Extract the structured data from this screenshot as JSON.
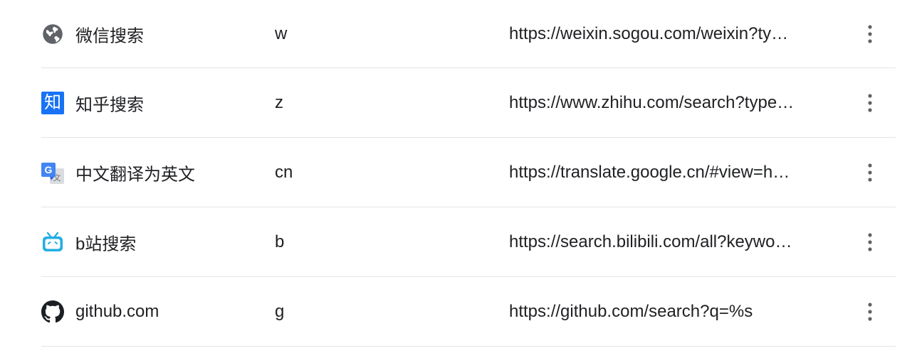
{
  "engines": [
    {
      "name": "微信搜索",
      "keyword": "w",
      "url": "https://weixin.sogou.com/weixin?ty…",
      "icon": "globe-icon"
    },
    {
      "name": "知乎搜索",
      "keyword": "z",
      "url": "https://www.zhihu.com/search?type…",
      "icon": "zhihu-icon",
      "icon_text": "知"
    },
    {
      "name": "中文翻译为英文",
      "keyword": "cn",
      "url": "https://translate.google.cn/#view=h…",
      "icon": "google-translate-icon"
    },
    {
      "name": "b站搜索",
      "keyword": "b",
      "url": "https://search.bilibili.com/all?keywo…",
      "icon": "bilibili-icon"
    },
    {
      "name": "github.com",
      "keyword": "g",
      "url": "https://github.com/search?q=%s",
      "icon": "github-icon"
    }
  ],
  "colors": {
    "text": "#202124",
    "divider": "#e4e4e4",
    "menu_dots": "#5f6368",
    "zhihu_blue": "#1772f6",
    "bilibili_blue": "#23ade5",
    "google_blue": "#4285f4"
  },
  "menu_icon": "more-vert-icon"
}
